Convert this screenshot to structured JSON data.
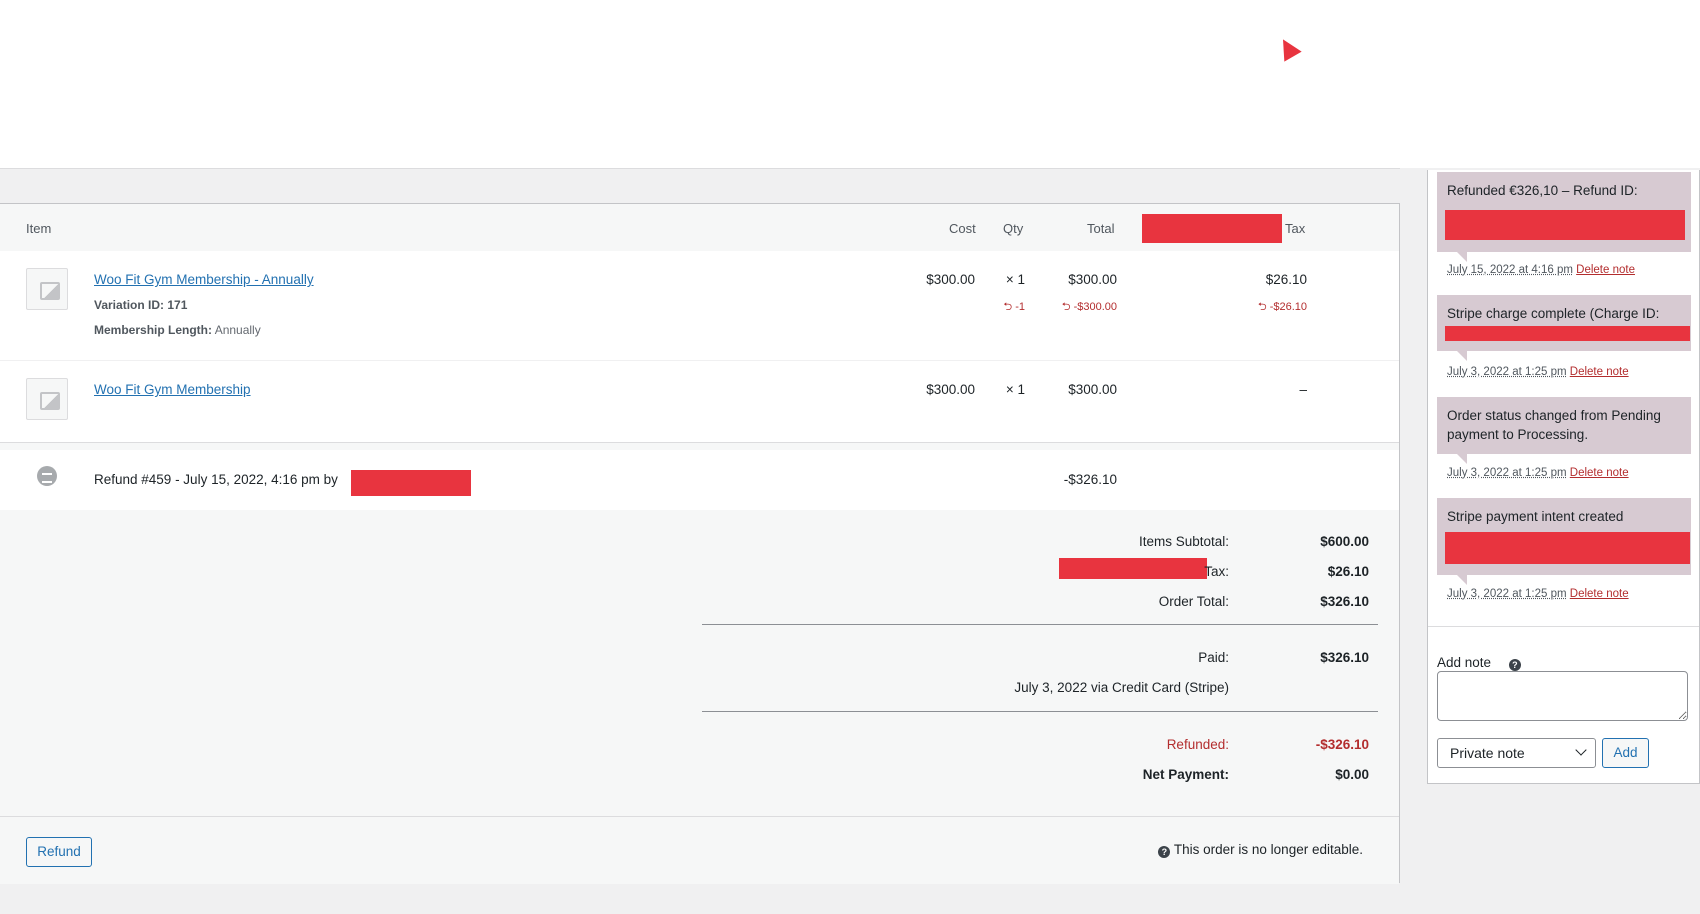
{
  "table": {
    "headers": {
      "item": "Item",
      "cost": "Cost",
      "qty": "Qty",
      "total": "Total",
      "tax": "Tax"
    },
    "items": [
      {
        "name": "Woo Fit Gym Membership - Annually",
        "variation_label": "Variation ID:",
        "variation_id": "171",
        "meta_label": "Membership Length:",
        "meta_value": "Annually",
        "cost": "$300.00",
        "qty": "× 1",
        "total": "$300.00",
        "tax": "$26.10",
        "refund_qty": "-1",
        "refund_total": "-$300.00",
        "refund_tax": "-$26.10"
      },
      {
        "name": "Woo Fit Gym Membership",
        "cost": "$300.00",
        "qty": "× 1",
        "total": "$300.00",
        "tax": "–"
      }
    ],
    "refund_row": {
      "text": "Refund #459 - July 15, 2022, 4:16 pm by",
      "amount": "-$326.10"
    }
  },
  "totals": {
    "items_subtotal_label": "Items Subtotal:",
    "items_subtotal": "$600.00",
    "tax_label": "Tax:",
    "tax": "$26.10",
    "order_total_label": "Order Total:",
    "order_total": "$326.10",
    "paid_label": "Paid:",
    "paid": "$326.10",
    "paid_via": "July 3, 2022 via Credit Card (Stripe)",
    "refunded_label": "Refunded:",
    "refunded": "-$326.10",
    "net_label": "Net Payment:",
    "net": "$0.00"
  },
  "actions": {
    "refund_button": "Refund",
    "not_editable": "This order is no longer editable."
  },
  "notes": [
    {
      "text": "Refunded €326,10 – Refund ID:",
      "date": "July 15, 2022 at 4:16 pm",
      "delete": "Delete note"
    },
    {
      "text": "Stripe charge complete (Charge ID:",
      "date": "July 3, 2022 at 1:25 pm",
      "delete": "Delete note"
    },
    {
      "text": "Order status changed from Pending payment to Processing.",
      "date": "July 3, 2022 at 1:25 pm",
      "delete": "Delete note"
    },
    {
      "text": "Stripe payment intent created",
      "date": "July 3, 2022 at 1:25 pm",
      "delete": "Delete note"
    }
  ],
  "add_note": {
    "label": "Add note",
    "note_type": "Private note",
    "add_button": "Add"
  },
  "colors": {
    "redaction": "#e8343f",
    "link": "#2271b1",
    "refund": "#b32d2e",
    "note_bg": "#d7cad2"
  }
}
